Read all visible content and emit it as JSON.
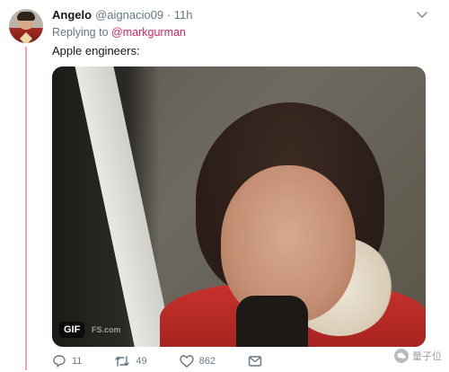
{
  "tweet": {
    "author_name": "Angelo",
    "meta": "@aignacio09 · 11h",
    "replying_prefix": "Replying to",
    "replying_handle": "@markgurman",
    "text": "Apple engineers:",
    "media_badge": "GIF",
    "media_watermark": "FS.com"
  },
  "actions": {
    "replies": "11",
    "retweets": "49",
    "likes": "862"
  },
  "watermark": {
    "text": "量子位"
  },
  "icons": {
    "menu": "chevron-down-icon",
    "reply": "reply-icon",
    "retweet": "retweet-icon",
    "like": "heart-icon",
    "share": "share-icon",
    "brand": "wechat-icon"
  },
  "colors": {
    "handle_link": "#e0245e",
    "thread_line": "#f2a6b8",
    "muted_text": "#657786"
  }
}
